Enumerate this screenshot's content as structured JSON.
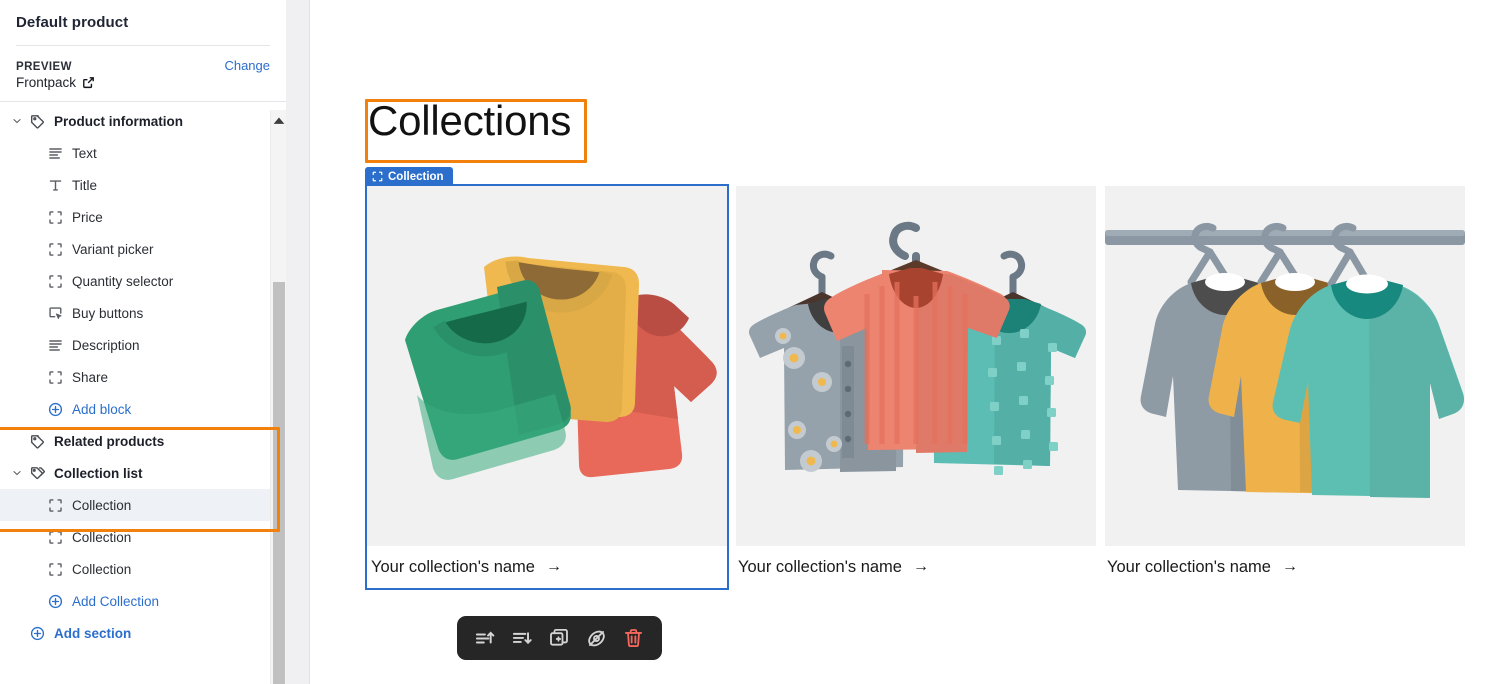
{
  "sidebar": {
    "title": "Default product",
    "preview_label": "PREVIEW",
    "change_label": "Change",
    "theme_name": "Frontpack",
    "external_icon": "external-link-icon",
    "tree": [
      {
        "id": "product-information",
        "label": "Product information",
        "type": "section",
        "icon": "tag-icon",
        "caret": "chevron-down-icon",
        "expanded": true
      },
      {
        "id": "text",
        "label": "Text",
        "type": "block",
        "icon": "text-icon"
      },
      {
        "id": "title",
        "label": "Title",
        "type": "block",
        "icon": "title-icon"
      },
      {
        "id": "price",
        "label": "Price",
        "type": "block",
        "icon": "block-icon"
      },
      {
        "id": "variant-picker",
        "label": "Variant picker",
        "type": "block",
        "icon": "block-icon"
      },
      {
        "id": "quantity-selector",
        "label": "Quantity selector",
        "type": "block",
        "icon": "block-icon"
      },
      {
        "id": "buy-buttons",
        "label": "Buy buttons",
        "type": "block",
        "icon": "cursor-button-icon"
      },
      {
        "id": "description",
        "label": "Description",
        "type": "block",
        "icon": "text-icon"
      },
      {
        "id": "share",
        "label": "Share",
        "type": "block",
        "icon": "block-icon"
      },
      {
        "id": "add-block",
        "label": "Add block",
        "type": "addlink",
        "icon": "plus-circle-icon"
      },
      {
        "id": "related-products",
        "label": "Related products",
        "type": "section",
        "icon": "tag-icon",
        "caret": "none"
      },
      {
        "id": "collection-list",
        "label": "Collection list",
        "type": "section",
        "icon": "tags-icon",
        "caret": "chevron-down-icon",
        "expanded": true
      },
      {
        "id": "collection-1",
        "label": "Collection",
        "type": "block",
        "icon": "block-icon",
        "selected": true
      },
      {
        "id": "collection-2",
        "label": "Collection",
        "type": "block",
        "icon": "block-icon"
      },
      {
        "id": "collection-3",
        "label": "Collection",
        "type": "block",
        "icon": "block-icon"
      },
      {
        "id": "add-collection",
        "label": "Add Collection",
        "type": "addlink",
        "icon": "plus-circle-icon"
      },
      {
        "id": "add-section",
        "label": "Add section",
        "type": "addsection",
        "icon": "plus-circle-icon"
      }
    ],
    "scrollbar": {
      "up_arrow_icon": "caret-up-icon"
    }
  },
  "canvas": {
    "heading": "Collections",
    "badge": {
      "label": "Collection",
      "icon": "block-icon"
    },
    "cards": [
      {
        "id": "card-1",
        "caption": "Your collection's name",
        "arrow": "→",
        "image": "folded-sweaters-illustration",
        "selected": true
      },
      {
        "id": "card-2",
        "caption": "Your collection's name",
        "arrow": "→",
        "image": "hanging-shirts-illustration",
        "selected": false
      },
      {
        "id": "card-3",
        "caption": "Your collection's name",
        "arrow": "→",
        "image": "sweaters-on-rail-illustration",
        "selected": false
      }
    ]
  },
  "toolbar": {
    "buttons": [
      {
        "id": "move-up",
        "icon": "move-up-icon"
      },
      {
        "id": "move-down",
        "icon": "move-down-icon"
      },
      {
        "id": "duplicate",
        "icon": "duplicate-icon"
      },
      {
        "id": "hide",
        "icon": "eye-slash-icon"
      },
      {
        "id": "delete",
        "icon": "trash-icon"
      }
    ]
  },
  "annotations": {
    "sidebar_box": "orange-highlight-sidebar",
    "heading_box": "orange-highlight-heading"
  },
  "colors": {
    "accent_blue": "#2c6ecb",
    "annotation_orange": "#f2800d",
    "selected_row_bg": "#eef1f6",
    "thumb_bg": "#f1f1f1",
    "toolbar_bg": "#262626",
    "danger_red": "#f4675d"
  }
}
